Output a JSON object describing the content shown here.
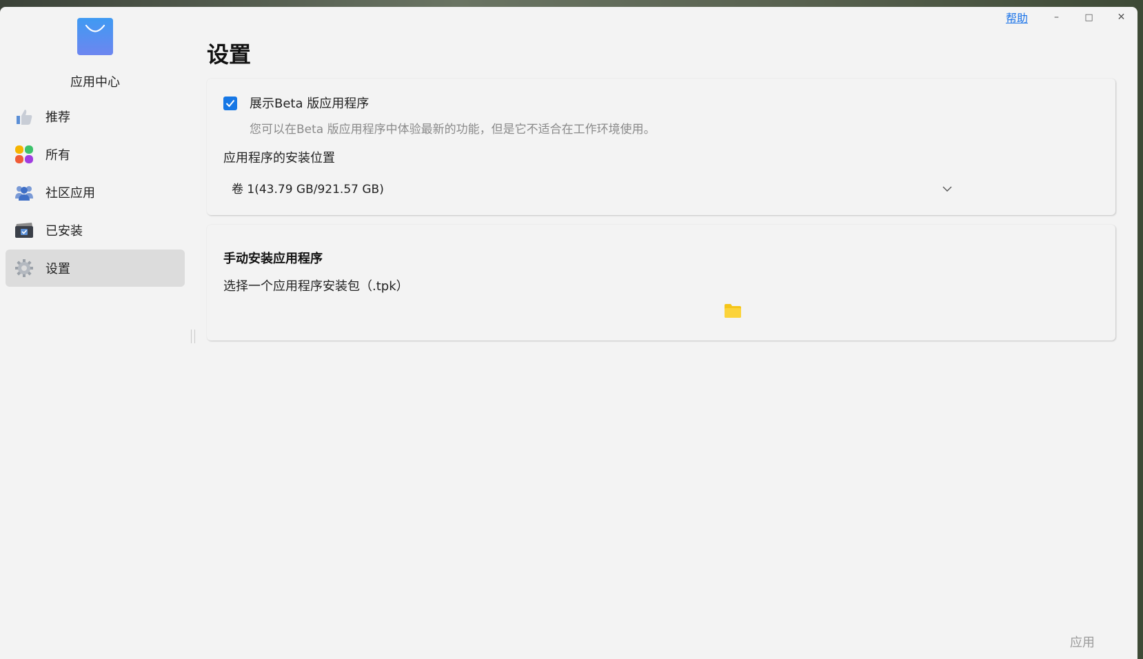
{
  "window": {
    "help_label": "帮助",
    "minimize_glyph": "–",
    "maximize_glyph": "□",
    "close_glyph": "✕"
  },
  "sidebar": {
    "app_name": "应用中心",
    "items": [
      {
        "label": "推荐",
        "icon": "thumbs-up-icon"
      },
      {
        "label": "所有",
        "icon": "all-apps-icon"
      },
      {
        "label": "社区应用",
        "icon": "community-icon"
      },
      {
        "label": "已安装",
        "icon": "installed-icon"
      },
      {
        "label": "设置",
        "icon": "gear-icon",
        "active": true
      }
    ]
  },
  "main": {
    "title": "设置",
    "beta": {
      "checked": true,
      "label": "展示Beta 版应用程序",
      "description": "您可以在Beta 版应用程序中体验最新的功能，但是它不适合在工作环境使用。"
    },
    "install_location": {
      "label": "应用程序的安装位置",
      "selected": "卷 1(43.79 GB/921.57 GB)"
    },
    "manual_install": {
      "title": "手动安装应用程序",
      "description": "选择一个应用程序安装包（.tpk）"
    },
    "apply_label": "应用"
  },
  "colors": {
    "accent": "#1677e5",
    "help_link": "#1a73e8",
    "folder": "#f5c518",
    "active_nav": "#dcdcdc"
  }
}
